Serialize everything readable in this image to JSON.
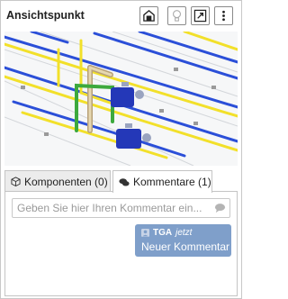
{
  "panel": {
    "title": "Ansichtspunkt"
  },
  "toolbar": {
    "buttons": [
      {
        "icon": "home-view-icon"
      },
      {
        "icon": "lightbulb-icon"
      },
      {
        "icon": "expand-icon"
      },
      {
        "icon": "more-vertical-icon"
      }
    ]
  },
  "viewport": {
    "description_icon": "3d-model-view"
  },
  "tabs": [
    {
      "label": "Komponenten (0)",
      "icon": "cube-icon",
      "active": false
    },
    {
      "label": "Kommentare (1)",
      "icon": "comments-icon",
      "active": true
    }
  ],
  "comments": {
    "input_placeholder": "Geben Sie hier Ihren Kommentar ein...",
    "items": [
      {
        "author": "TGA",
        "time": "jetzt",
        "text": "Neuer Kommentar"
      }
    ]
  },
  "colors": {
    "bubble": "#7f9fca",
    "pipe_blue": "#2b4fd8",
    "pipe_yellow": "#f2e02a",
    "pipe_green": "#3da93d"
  }
}
